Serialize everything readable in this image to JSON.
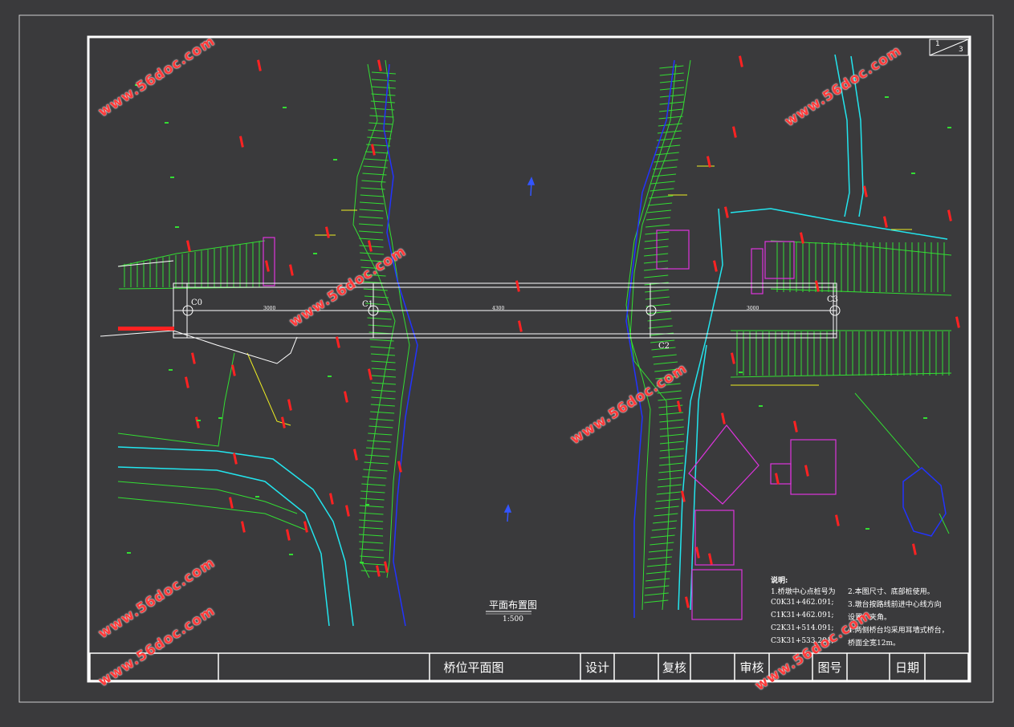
{
  "sheet": {
    "index": "1",
    "total": "3"
  },
  "drawing": {
    "title": "平面布置图",
    "scale": "1:500",
    "axes": [
      "C0",
      "C1",
      "C2",
      "C3"
    ],
    "spans": [
      "3000",
      "4300",
      "3000"
    ]
  },
  "notes": {
    "heading": "说明:",
    "left": [
      "1.桥墩中心点桩号为",
      "C0K31+462.091;",
      "C1K31+462.091;",
      "C2K31+514.091;",
      "C3K31+533.291;"
    ],
    "right": [
      "2.本图尺寸、底部桩使用。",
      "3.墩台按路线前进中心线方向",
      "设置，夹角。",
      "4.两侧桥台均采用耳墙式桥台，",
      "桥面全宽12m。"
    ]
  },
  "title_block": {
    "name": "桥位平面图",
    "design": "设计",
    "check": "复核",
    "review": "审核",
    "drawing_no": "图号",
    "date": "日期"
  },
  "watermark": "www.56doc.com",
  "colors": {
    "background": "#3a3a3c",
    "frame": "#ffffff",
    "contour_green": "#33dd33",
    "water_blue": "#2233ff",
    "road_cyan": "#22e5ee",
    "building_magenta": "#dd33dd",
    "label_red": "#ff2222",
    "yellow": "#eeee22"
  }
}
